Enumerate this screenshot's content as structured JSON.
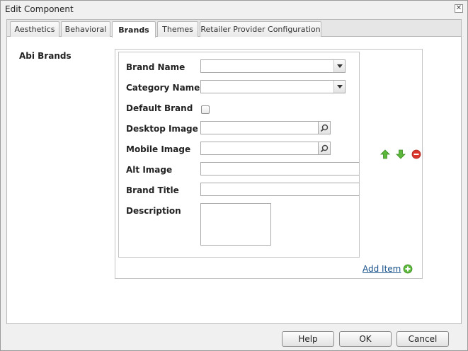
{
  "dialog": {
    "title": "Edit Component",
    "close_glyph": "✕"
  },
  "tabs": [
    {
      "label": "Aesthetics",
      "active": false
    },
    {
      "label": "Behavioral",
      "active": false
    },
    {
      "label": "Brands",
      "active": true
    },
    {
      "label": "Themes",
      "active": false
    },
    {
      "label": "Retailer Provider Configuration",
      "active": false
    }
  ],
  "brands": {
    "section_label": "Abi Brands",
    "fields": {
      "brand_name": {
        "label": "Brand Name",
        "value": ""
      },
      "category_name": {
        "label": "Category Name",
        "value": ""
      },
      "default_brand": {
        "label": "Default Brand",
        "checked": false
      },
      "desktop_image": {
        "label": "Desktop Image",
        "value": ""
      },
      "mobile_image": {
        "label": "Mobile Image",
        "value": ""
      },
      "alt_image": {
        "label": "Alt Image",
        "value": ""
      },
      "brand_title": {
        "label": "Brand Title",
        "value": ""
      },
      "description": {
        "label": "Description",
        "value": ""
      }
    },
    "item_controls": {
      "move_up_icon": "arrow-up-icon",
      "move_down_icon": "arrow-down-icon",
      "remove_icon": "remove-icon"
    },
    "add_item_label": "Add Item"
  },
  "footer": {
    "help_label": "Help",
    "ok_label": "OK",
    "cancel_label": "Cancel"
  },
  "colors": {
    "link": "#15508a",
    "add_green": "#5cb83a",
    "remove_red": "#d9352b"
  }
}
